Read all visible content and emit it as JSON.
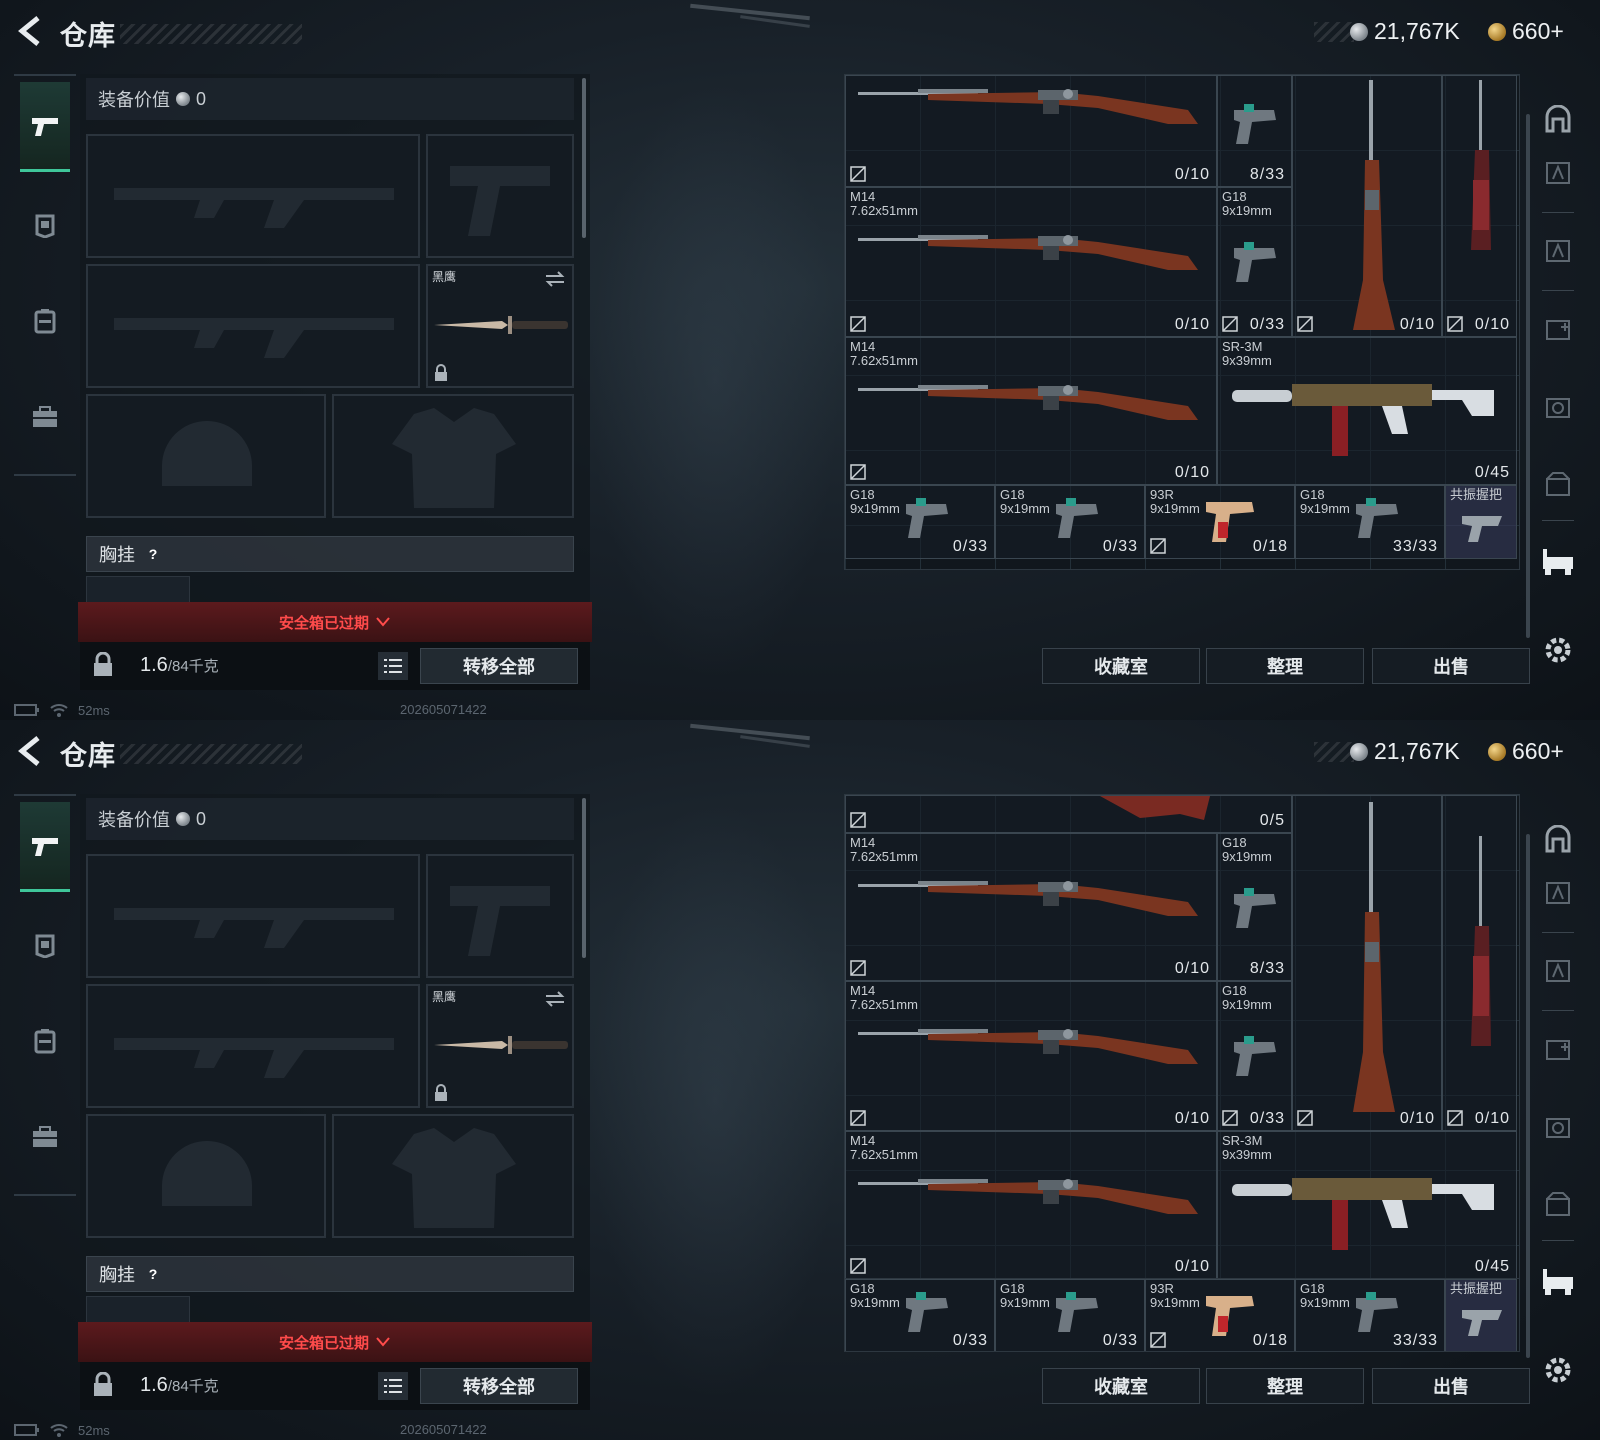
{
  "header": {
    "title": "仓库",
    "silver": "21,767K",
    "gold": "660+"
  },
  "equipment": {
    "value_label": "装备价值",
    "value": "0",
    "melee_name": "黑鹰",
    "chest_rig_label": "胸挂",
    "help": "?",
    "safe_box_expired": "安全箱已过期",
    "weight_current": "1.6",
    "weight_max": "/84千克",
    "transfer_all": "转移全部"
  },
  "status": {
    "ping": "52ms",
    "build": "202605071422"
  },
  "actions": {
    "collection": "收藏室",
    "sort": "整理",
    "sell": "出售"
  },
  "screen1_items": [
    {
      "name": "",
      "caliber": "",
      "ammo": "0/10"
    },
    {
      "name": "",
      "caliber": "",
      "ammo": "8/33"
    },
    {
      "name": "M14",
      "caliber": "7.62x51mm",
      "ammo": "0/10"
    },
    {
      "name": "G18",
      "caliber": "9x19mm",
      "ammo": "0/33"
    },
    {
      "name": "",
      "caliber": "",
      "ammo": "0/10"
    },
    {
      "name": "",
      "caliber": "",
      "ammo": "0/10"
    },
    {
      "name": "M14",
      "caliber": "7.62x51mm",
      "ammo": "0/10"
    },
    {
      "name": "SR-3M",
      "caliber": "9x39mm",
      "ammo": "0/45"
    },
    {
      "name": "G18",
      "caliber": "9x19mm",
      "ammo": "0/33"
    },
    {
      "name": "G18",
      "caliber": "9x19mm",
      "ammo": "0/33"
    },
    {
      "name": "93R",
      "caliber": "9x19mm",
      "ammo": "0/18"
    },
    {
      "name": "G18",
      "caliber": "9x19mm",
      "ammo": "33/33"
    },
    {
      "name": "共振握把",
      "caliber": "",
      "ammo": ""
    }
  ],
  "screen2_items": [
    {
      "name": "",
      "caliber": "",
      "ammo": "0/5"
    },
    {
      "name": "M14",
      "caliber": "7.62x51mm",
      "ammo": "0/10"
    },
    {
      "name": "G18",
      "caliber": "9x19mm",
      "ammo": "8/33"
    },
    {
      "name": "M14",
      "caliber": "7.62x51mm",
      "ammo": "0/10"
    },
    {
      "name": "G18",
      "caliber": "9x19mm",
      "ammo": "0/33"
    },
    {
      "name": "",
      "caliber": "",
      "ammo": "0/10"
    },
    {
      "name": "",
      "caliber": "",
      "ammo": "0/10"
    },
    {
      "name": "M14",
      "caliber": "7.62x51mm",
      "ammo": "0/10"
    },
    {
      "name": "SR-3M",
      "caliber": "9x39mm",
      "ammo": "0/45"
    },
    {
      "name": "G18",
      "caliber": "9x19mm",
      "ammo": "0/33"
    },
    {
      "name": "G18",
      "caliber": "9x19mm",
      "ammo": "0/33"
    },
    {
      "name": "93R",
      "caliber": "9x19mm",
      "ammo": "0/18"
    },
    {
      "name": "G18",
      "caliber": "9x19mm",
      "ammo": "33/33"
    },
    {
      "name": "共振握把",
      "caliber": "",
      "ammo": ""
    }
  ],
  "colors": {
    "accent_green": "#3fc79a",
    "warning_red": "#ff4b4b",
    "wood": "#7a3520"
  }
}
